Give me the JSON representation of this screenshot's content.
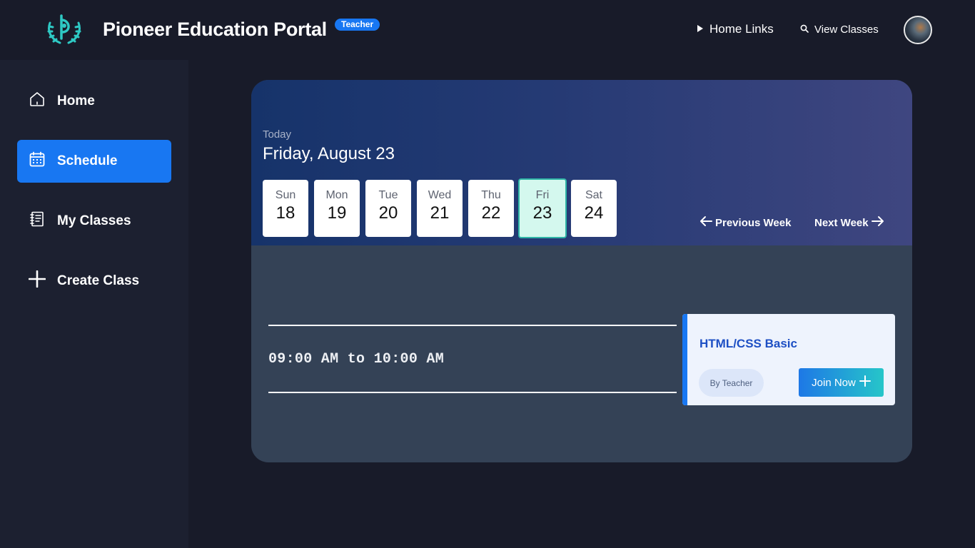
{
  "header": {
    "brand_title": "Pioneer Education Portal",
    "role_badge": "Teacher",
    "nav_home_links": "Home Links",
    "nav_view_classes": "View Classes"
  },
  "sidebar": {
    "items": [
      {
        "label": "Home",
        "icon": "home-icon",
        "active": false
      },
      {
        "label": "Schedule",
        "icon": "calendar-icon",
        "active": true
      },
      {
        "label": "My Classes",
        "icon": "notebook-icon",
        "active": false
      },
      {
        "label": "Create Class",
        "icon": "plus-icon",
        "active": false
      }
    ]
  },
  "schedule": {
    "today_label": "Today",
    "today_date": "Friday, August 23",
    "days": [
      {
        "name": "Sun",
        "num": "18"
      },
      {
        "name": "Mon",
        "num": "19"
      },
      {
        "name": "Tue",
        "num": "20"
      },
      {
        "name": "Wed",
        "num": "21"
      },
      {
        "name": "Thu",
        "num": "22"
      },
      {
        "name": "Fri",
        "num": "23",
        "selected": true
      },
      {
        "name": "Sat",
        "num": "24"
      }
    ],
    "previous_week": "Previous Week",
    "next_week": "Next Week",
    "time_range": "09:00 AM to 10:00 AM",
    "class": {
      "title": "HTML/CSS Basic",
      "by": "By Teacher",
      "join_label": "Join Now"
    }
  },
  "colors": {
    "accent": "#1877f2",
    "selected_day_bg": "#d4f8ee",
    "selected_day_border": "#2fb5a6",
    "class_title": "#1d4fc4"
  }
}
